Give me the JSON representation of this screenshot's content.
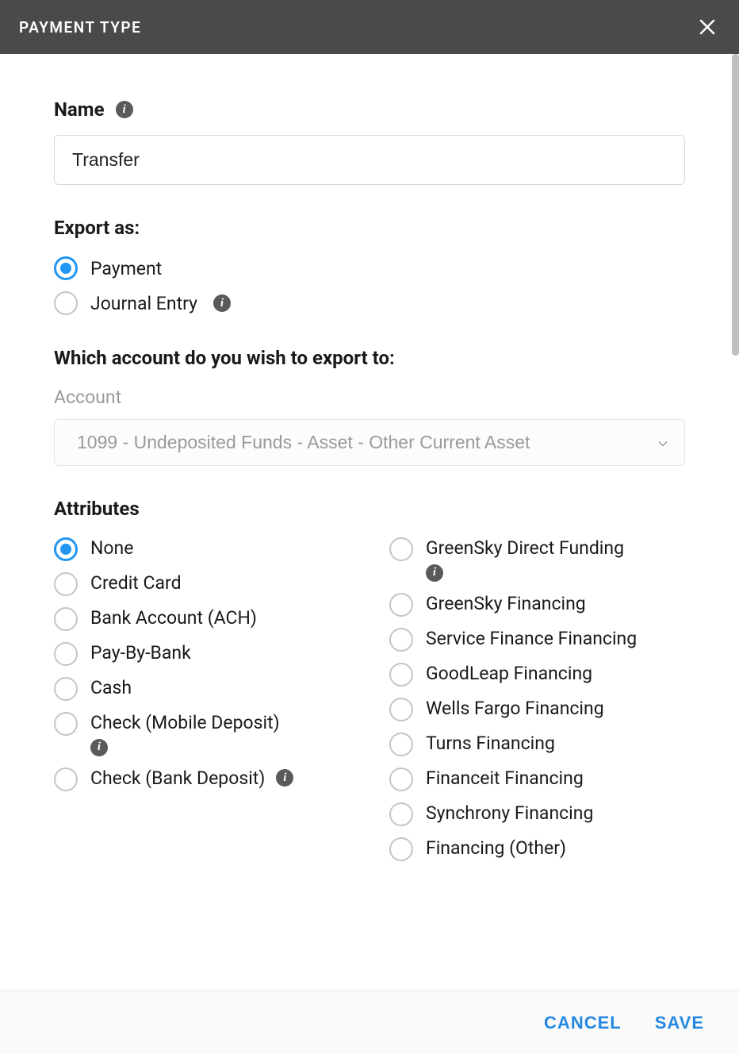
{
  "header": {
    "title": "PAYMENT TYPE"
  },
  "name": {
    "label": "Name",
    "value": "Transfer"
  },
  "export_as": {
    "label": "Export as:",
    "options": [
      {
        "label": "Payment",
        "selected": true,
        "info": false
      },
      {
        "label": "Journal Entry",
        "selected": false,
        "info": true
      }
    ]
  },
  "account_section": {
    "label": "Which account do you wish to export to:",
    "sublabel": "Account",
    "selected": "1099 - Undeposited Funds - Asset - Other Current Asset"
  },
  "attributes": {
    "label": "Attributes",
    "left": [
      {
        "label": "None",
        "selected": true,
        "info": false
      },
      {
        "label": "Credit Card",
        "selected": false,
        "info": false
      },
      {
        "label": "Bank Account (ACH)",
        "selected": false,
        "info": false
      },
      {
        "label": "Pay-By-Bank",
        "selected": false,
        "info": false
      },
      {
        "label": "Cash",
        "selected": false,
        "info": false
      },
      {
        "label": "Check (Mobile Deposit)",
        "selected": false,
        "info": "below"
      },
      {
        "label": "Check (Bank Deposit)",
        "selected": false,
        "info": "inline"
      }
    ],
    "right": [
      {
        "label": "GreenSky Direct Funding",
        "selected": false,
        "info": "below"
      },
      {
        "label": "GreenSky Financing",
        "selected": false,
        "info": false
      },
      {
        "label": "Service Finance Financing",
        "selected": false,
        "info": false
      },
      {
        "label": "GoodLeap Financing",
        "selected": false,
        "info": false
      },
      {
        "label": "Wells Fargo Financing",
        "selected": false,
        "info": false
      },
      {
        "label": "Turns Financing",
        "selected": false,
        "info": false
      },
      {
        "label": "Financeit Financing",
        "selected": false,
        "info": false
      },
      {
        "label": "Synchrony Financing",
        "selected": false,
        "info": false
      },
      {
        "label": "Financing (Other)",
        "selected": false,
        "info": false
      }
    ]
  },
  "footer": {
    "cancel": "CANCEL",
    "save": "SAVE"
  }
}
